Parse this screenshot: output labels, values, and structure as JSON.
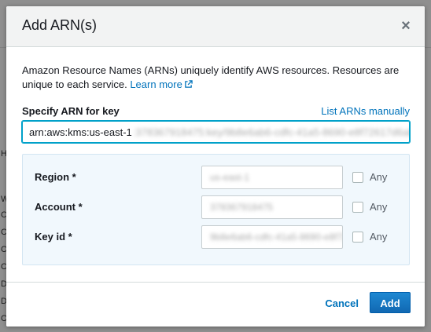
{
  "background": {
    "left_glyphs": [
      "H",
      "W",
      "C",
      "C",
      "C",
      "C",
      "D",
      "D",
      "C"
    ]
  },
  "modal": {
    "title": "Add ARN(s)",
    "close_symbol": "×",
    "description": "Amazon Resource Names (ARNs) uniquely identify AWS resources. Resources are unique to each service.",
    "learn_more": "Learn more",
    "arn_label": "Specify ARN for key",
    "list_link": "List ARNs manually",
    "arn_value_visible": "arn:aws:kms:us-east-1",
    "arn_value_redacted": ":378367918475:key/9b8e6ab6-cdfc-41a5-8690-e8f72617d6ab",
    "fields": [
      {
        "label": "Region *",
        "value": "us-east-1",
        "any_label": "Any",
        "any_checked": false
      },
      {
        "label": "Account *",
        "value": "378367918475",
        "any_label": "Any",
        "any_checked": false
      },
      {
        "label": "Key id *",
        "value": "9b8e6ab6-cdfc-41a5-8690-e8f72617d6ab",
        "any_label": "Any",
        "any_checked": false
      }
    ],
    "cancel_label": "Cancel",
    "add_label": "Add"
  },
  "colors": {
    "accent": "#0073bb",
    "focus": "#00a1c9",
    "panel_bg": "#f1f8fd"
  }
}
